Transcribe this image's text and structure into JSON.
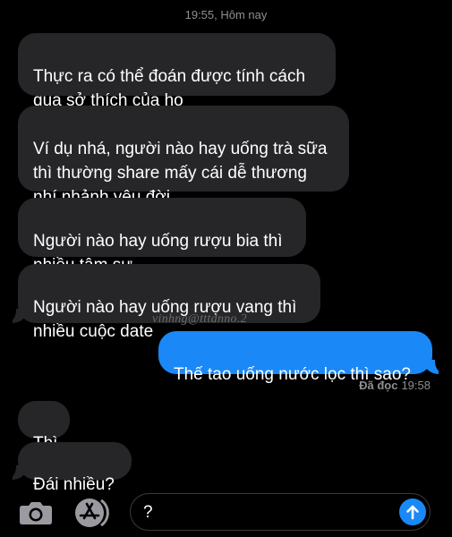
{
  "header": {
    "timestamp": "19:55, Hôm nay"
  },
  "messages": [
    {
      "direction": "incoming",
      "text": "Thực ra có thể đoán được tính cách\nqua sở thích của họ"
    },
    {
      "direction": "incoming",
      "text": "Ví dụ nhá, người nào hay uống trà sữa\nthì thường share mấy cái dễ thương\nnhí nhảnh yêu đời"
    },
    {
      "direction": "incoming",
      "text": "Người nào hay uống rượu bia thì\nnhiều tâm sự"
    },
    {
      "direction": "incoming",
      "text": "Người nào hay uống rượu vang thì\nnhiều cuộc date"
    },
    {
      "direction": "outgoing",
      "text": "Thế tao uống nước lọc thì sao?"
    },
    {
      "direction": "incoming",
      "text": "Thì"
    },
    {
      "direction": "incoming",
      "text": "Đái nhiều?"
    }
  ],
  "watermark": "vinhng@tttdnno.2",
  "read_receipt": {
    "label": "Đã đọc",
    "time": "19:58"
  },
  "composer": {
    "value": "?",
    "camera_icon": "camera-icon",
    "apps_icon": "app-store-icon",
    "send_icon": "arrow-up-icon"
  },
  "colors": {
    "incoming_bubble": "#262628",
    "outgoing_bubble": "#1a88f7",
    "background": "#000000",
    "meta_text": "#8e8e93"
  }
}
